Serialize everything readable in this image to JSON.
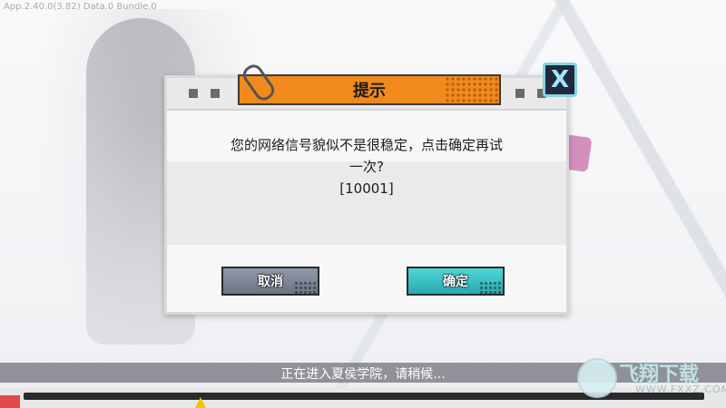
{
  "build_info": "App.2.40.0(3.82) Data.0 Bundle.0",
  "dialog": {
    "title": "提示",
    "message_line1": "您的网络信号貌似不是很稳定，点击确定再试",
    "message_line2": "一次?",
    "error_code": "[10001]",
    "cancel_label": "取消",
    "ok_label": "确定",
    "close_label": "X"
  },
  "loading": {
    "status_text": "正在进入夏侯学院，请稍候...",
    "progress": 0.26
  },
  "watermark": {
    "text": "飞翔下载",
    "url": "WWW.FXXZ.COM"
  },
  "colors": {
    "title_tab": "#f08a1c",
    "ok_button": "#28aab0",
    "cancel_button": "#6b7584",
    "close_border": "#8ad1e6"
  },
  "icons": {
    "close": "close-icon",
    "paperclip": "paperclip-icon"
  }
}
